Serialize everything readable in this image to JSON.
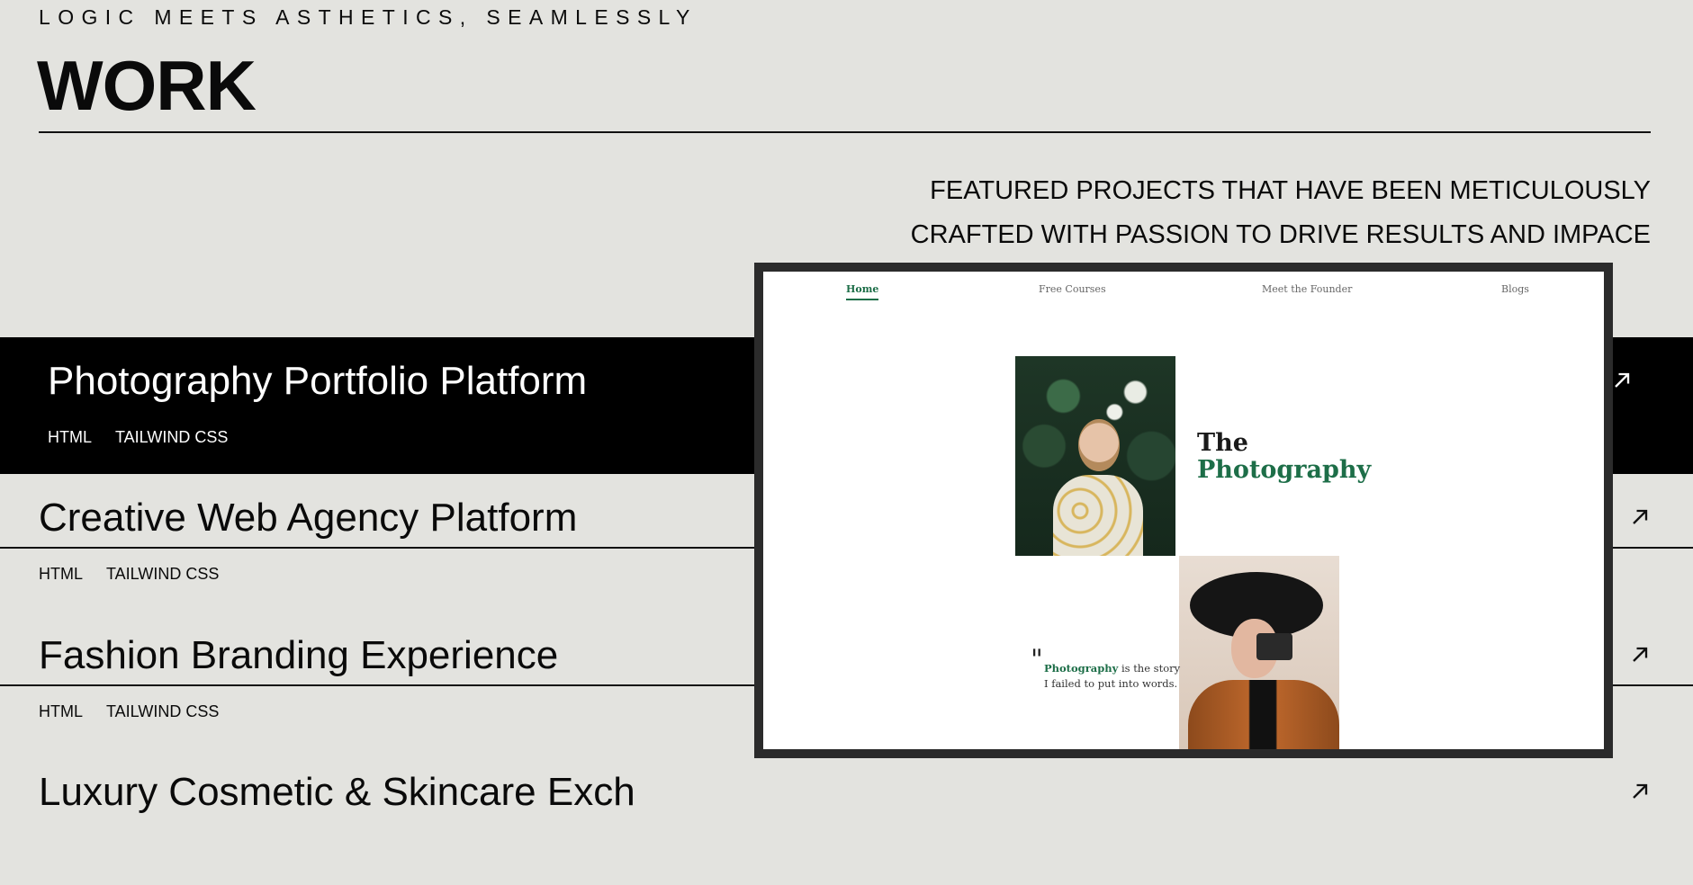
{
  "tagline": "LOGIC MEETS ASTHETICS, SEAMLESSLY",
  "heading": "WORK",
  "intro": "FEATURED PROJECTS THAT HAVE BEEN METICULOUSLY CRAFTED WITH PASSION TO DRIVE RESULTS AND IMPACE",
  "projects": [
    {
      "title": "Photography Portfolio Platform",
      "tags": [
        "HTML",
        "TAILWIND CSS"
      ],
      "icon": "arrow-up-right-icon"
    },
    {
      "title": "Creative Web Agency Platform",
      "tags": [
        "HTML",
        "TAILWIND CSS"
      ],
      "icon": "arrow-up-right-icon"
    },
    {
      "title": "Fashion Branding Experience",
      "tags": [
        "HTML",
        "TAILWIND CSS"
      ],
      "icon": "arrow-up-right-icon"
    },
    {
      "title": "Luxury Cosmetic & Skincare Exch",
      "tags": [],
      "icon": "arrow-up-right-icon"
    }
  ],
  "preview": {
    "nav": [
      "Home",
      "Free Courses",
      "Meet the Founder",
      "Blogs"
    ],
    "title_line1": "The",
    "title_line2": "Photography",
    "quote_mark": "\"",
    "quote_highlight": "Photography",
    "quote_rest": " is the story",
    "quote_line2": "I failed to put into words."
  },
  "colors": {
    "background": "#e3e3df",
    "text": "#0a0a0a",
    "active_row": "#000000",
    "preview_accent": "#1d6e48"
  }
}
